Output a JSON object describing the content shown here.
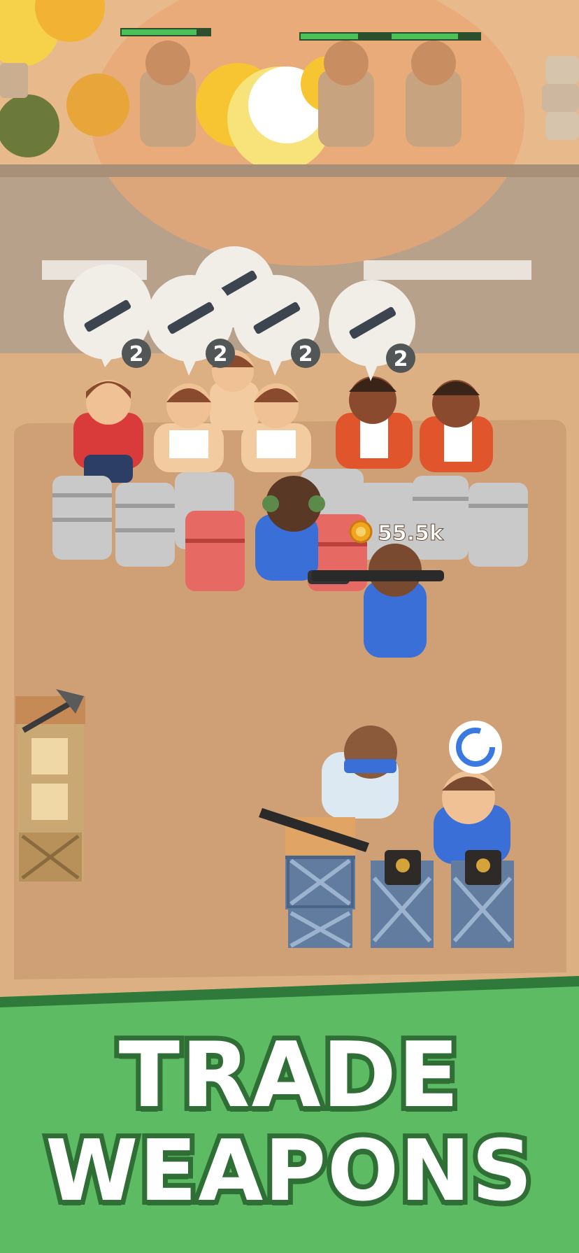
{
  "banner": {
    "line1": "TRADE",
    "line2": "WEAPONS"
  },
  "hud": {
    "coin_amount": "55.5k",
    "coin_icon": "coin-icon"
  },
  "customers": {
    "requests": [
      {
        "item": "rifle-icon",
        "count": "2"
      },
      {
        "item": "rifle-icon",
        "count": "2"
      },
      {
        "item": "rifle-icon",
        "count": "2"
      },
      {
        "item": "rifle-icon",
        "count": "2"
      },
      {
        "item": "rifle-icon",
        "count": ""
      }
    ]
  },
  "enemies": {
    "health_levels": [
      0.85,
      0.65,
      0.75
    ]
  },
  "colors": {
    "banner_green": "#5dbb63",
    "banner_outline": "#2f6e35",
    "ground": "#d9ae82",
    "road": "#b39b85",
    "player_blue": "#3a6fd8"
  }
}
